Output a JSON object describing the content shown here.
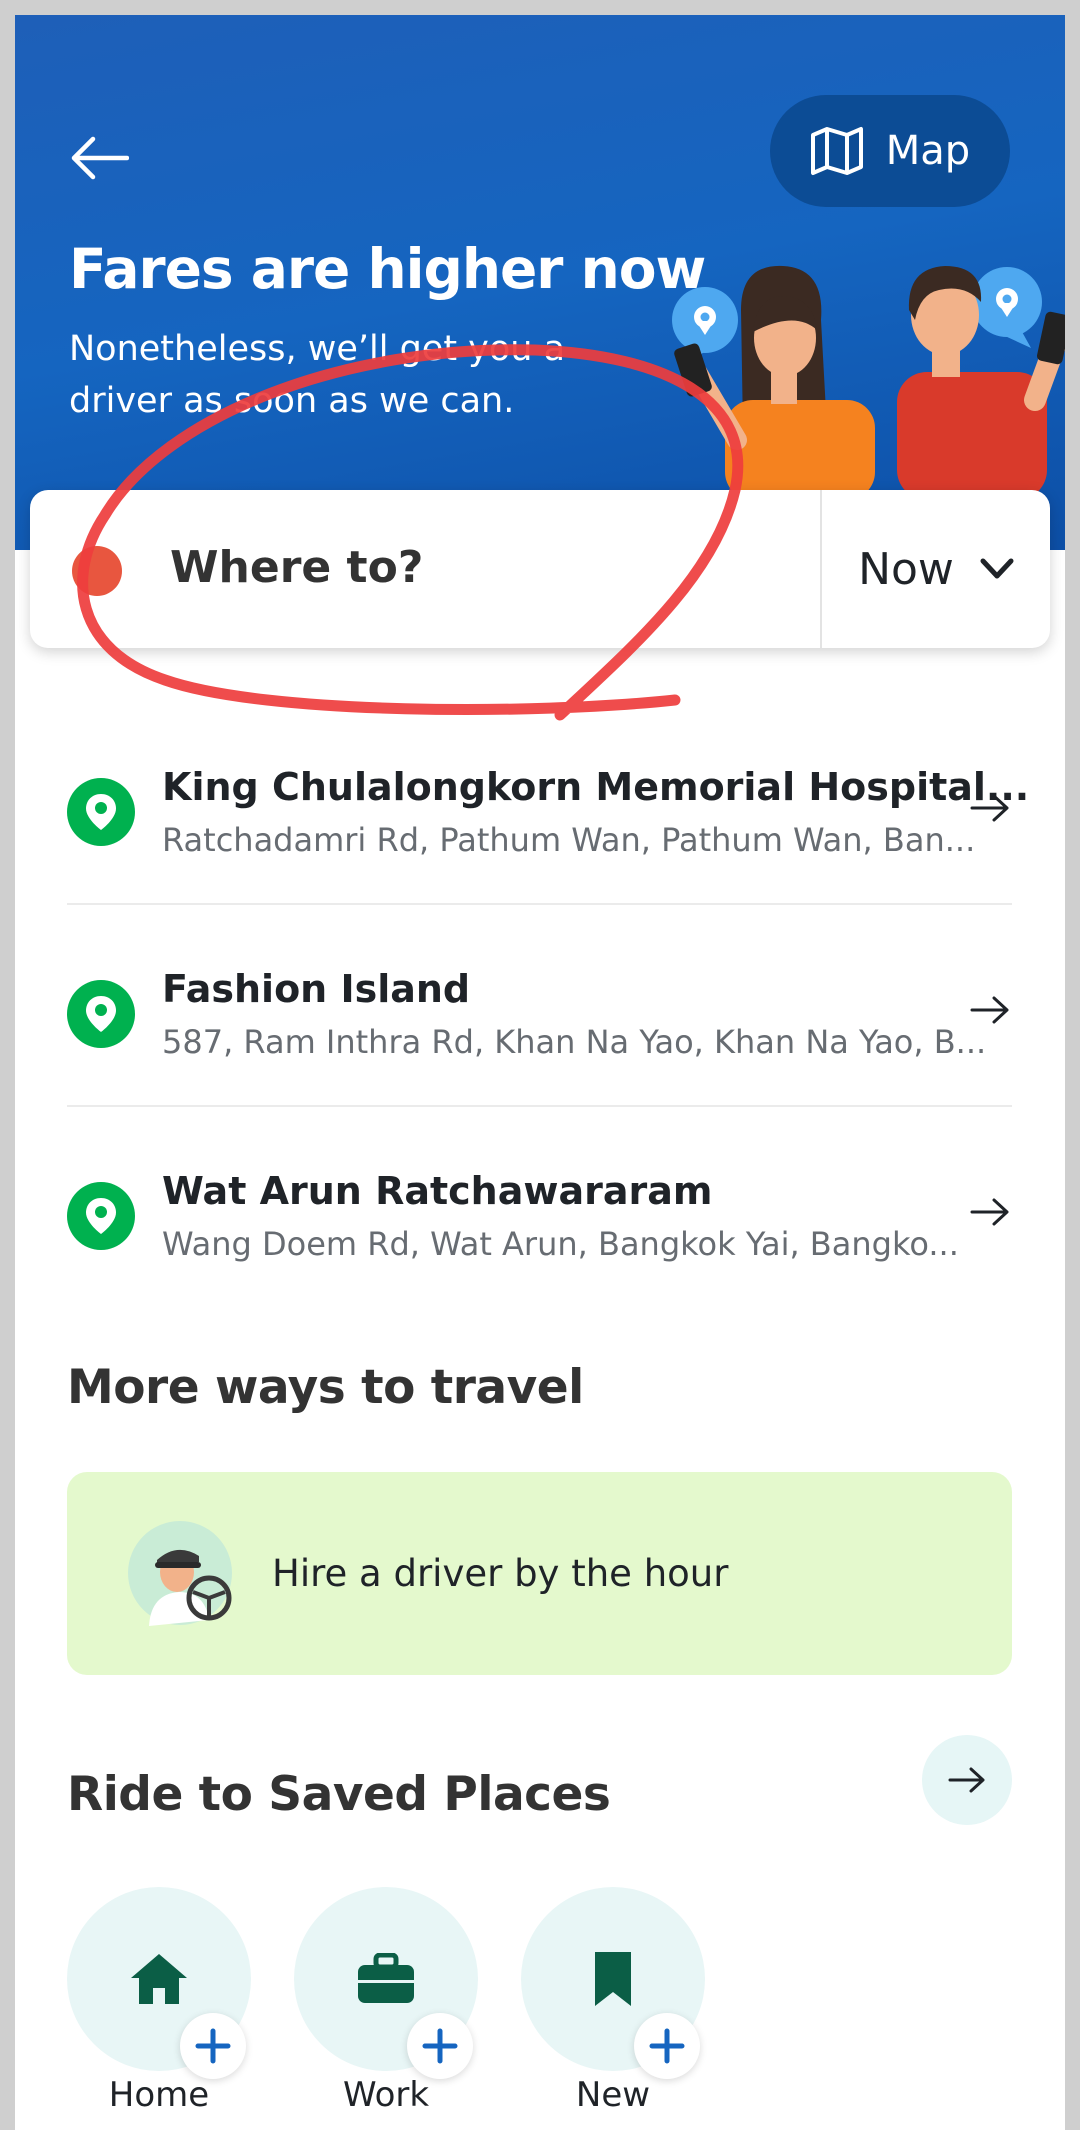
{
  "header": {
    "back_label": "",
    "map_label": "Map",
    "title": "Fares are higher now",
    "subtitle": "Nonetheless, we’ll get you a driver as soon as we can."
  },
  "search": {
    "placeholder": "Where to?",
    "time_label": "Now"
  },
  "recent_places": [
    {
      "name": "King Chulalongkorn Memorial Hospital...",
      "address": "Ratchadamri Rd, Pathum Wan, Pathum Wan, Ban..."
    },
    {
      "name": "Fashion Island",
      "address": "587, Ram Inthra Rd, Khan Na Yao, Khan Na Yao, B..."
    },
    {
      "name": "Wat Arun Ratchawararam",
      "address": "Wang Doem Rd, Wat Arun, Bangkok Yai, Bangko..."
    }
  ],
  "more_ways": {
    "title": "More ways to travel",
    "hire_driver_label": "Hire a driver by the hour"
  },
  "saved_places": {
    "title": "Ride to Saved Places",
    "items": [
      {
        "label": "Home",
        "icon": "home-icon"
      },
      {
        "label": "Work",
        "icon": "briefcase-icon"
      },
      {
        "label": "New",
        "icon": "bookmark-icon"
      }
    ]
  },
  "colors": {
    "header_blue": "#1565c0",
    "map_button": "#0c4c95",
    "grab_green": "#00b14f",
    "hire_card_bg": "#e4f9cd",
    "annotation_red": "#ee3d3d"
  }
}
